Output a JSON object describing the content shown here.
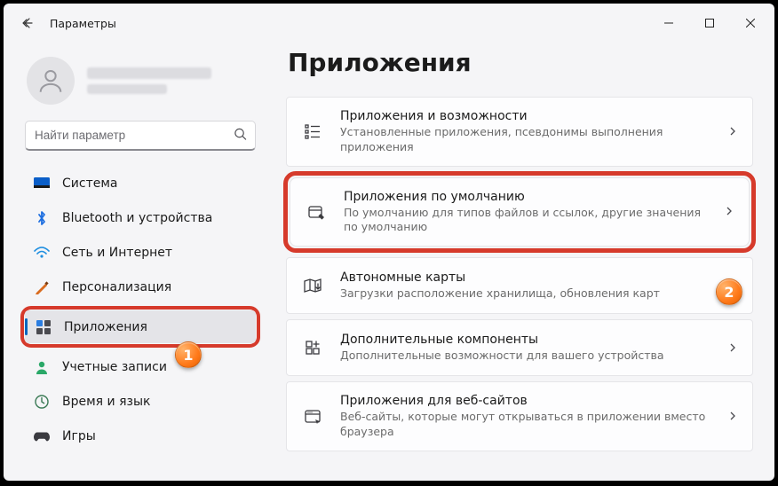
{
  "window": {
    "title": "Параметры"
  },
  "search": {
    "placeholder": "Найти параметр"
  },
  "sidebar": {
    "items": [
      {
        "label": "Система"
      },
      {
        "label": "Bluetooth и устройства"
      },
      {
        "label": "Сеть и Интернет"
      },
      {
        "label": "Персонализация"
      },
      {
        "label": "Приложения"
      },
      {
        "label": "Учетные записи"
      },
      {
        "label": "Время и язык"
      },
      {
        "label": "Игры"
      }
    ],
    "selected_index": 4
  },
  "page": {
    "title": "Приложения"
  },
  "cards": [
    {
      "title": "Приложения и возможности",
      "subtitle": "Установленные приложения, псевдонимы выполнения приложения"
    },
    {
      "title": "Приложения по умолчанию",
      "subtitle": "По умолчанию для типов файлов и ссылок, другие значения по умолчанию"
    },
    {
      "title": "Автономные карты",
      "subtitle": "Загрузки расположение хранилища, обновления карт"
    },
    {
      "title": "Дополнительные компоненты",
      "subtitle": "Дополнительные возможности для вашего устройства"
    },
    {
      "title": "Приложения для веб-сайтов",
      "subtitle": "Веб-сайты, которые могут открываться в приложении вместо браузера"
    }
  ],
  "annotations": {
    "badge1": "1",
    "badge2": "2"
  }
}
